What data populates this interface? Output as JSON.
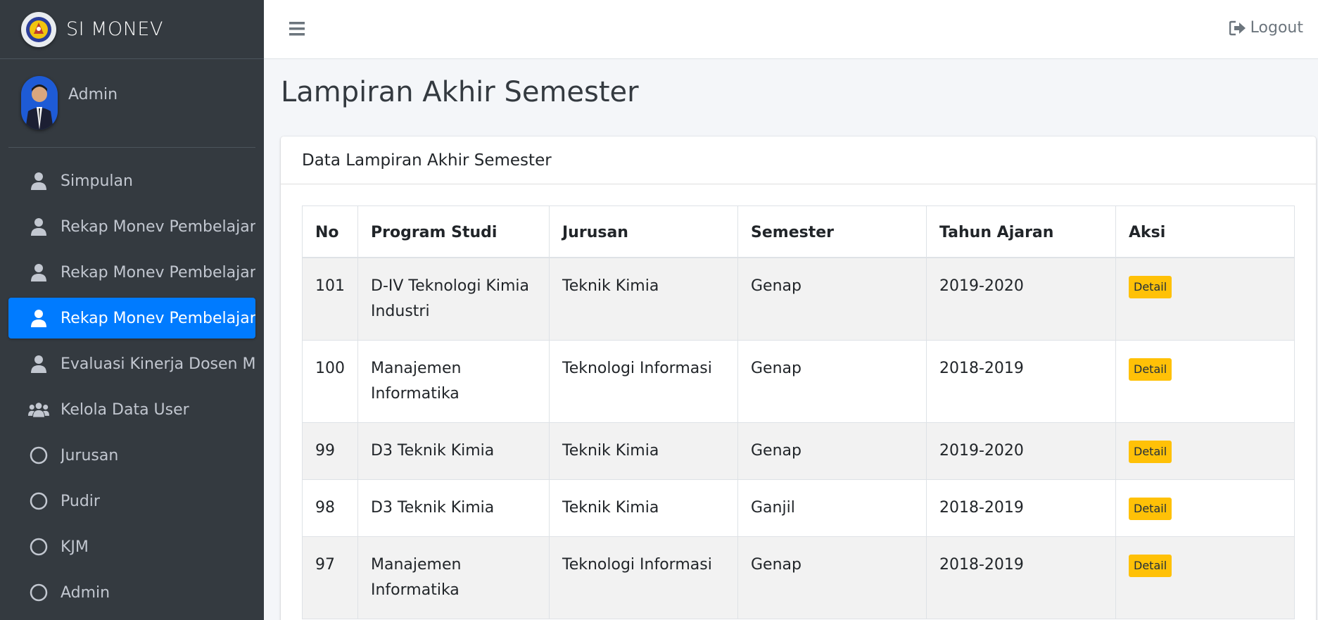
{
  "brand": {
    "title": "SI MONEV",
    "logo_icon": "institution-logo"
  },
  "user": {
    "name": "Admin"
  },
  "sidebar": {
    "items": [
      {
        "label": "Simpulan",
        "icon": "user-icon",
        "active": false
      },
      {
        "label": "Rekap Monev Pembelajaran",
        "icon": "user-icon",
        "active": false
      },
      {
        "label": "Rekap Monev Pembelajaran",
        "icon": "user-icon",
        "active": false
      },
      {
        "label": "Rekap Monev Pembelajaran",
        "icon": "user-icon",
        "active": true
      },
      {
        "label": "Evaluasi Kinerja Dosen Mata",
        "icon": "user-icon",
        "active": false
      },
      {
        "label": "Kelola Data User",
        "icon": "users-icon",
        "active": false
      },
      {
        "label": "Jurusan",
        "icon": "circle-icon",
        "active": false
      },
      {
        "label": "Pudir",
        "icon": "circle-icon",
        "active": false
      },
      {
        "label": "KJM",
        "icon": "circle-icon",
        "active": false
      },
      {
        "label": "Admin",
        "icon": "circle-icon",
        "active": false
      }
    ]
  },
  "navbar": {
    "logout_label": "Logout"
  },
  "page": {
    "title": "Lampiran Akhir Semester"
  },
  "card": {
    "title": "Data Lampiran Akhir Semester"
  },
  "table": {
    "headers": [
      "No",
      "Program Studi",
      "Jurusan",
      "Semester",
      "Tahun Ajaran",
      "Aksi"
    ],
    "rows": [
      {
        "no": "101",
        "prodi": "D-IV Teknologi Kimia Industri",
        "jurusan": "Teknik Kimia",
        "semester": "Genap",
        "tahun": "2019-2020",
        "aksi": "Detail"
      },
      {
        "no": "100",
        "prodi": "Manajemen Informatika",
        "jurusan": "Teknologi Informasi",
        "semester": "Genap",
        "tahun": "2018-2019",
        "aksi": "Detail"
      },
      {
        "no": "99",
        "prodi": "D3 Teknik Kimia",
        "jurusan": "Teknik Kimia",
        "semester": "Genap",
        "tahun": "2019-2020",
        "aksi": "Detail"
      },
      {
        "no": "98",
        "prodi": "D3 Teknik Kimia",
        "jurusan": "Teknik Kimia",
        "semester": "Ganjil",
        "tahun": "2018-2019",
        "aksi": "Detail"
      },
      {
        "no": "97",
        "prodi": "Manajemen Informatika",
        "jurusan": "Teknologi Informasi",
        "semester": "Genap",
        "tahun": "2018-2019",
        "aksi": "Detail"
      }
    ]
  },
  "colors": {
    "sidebar_bg": "#343a40",
    "active": "#007bff",
    "detail_button": "#ffc107"
  }
}
